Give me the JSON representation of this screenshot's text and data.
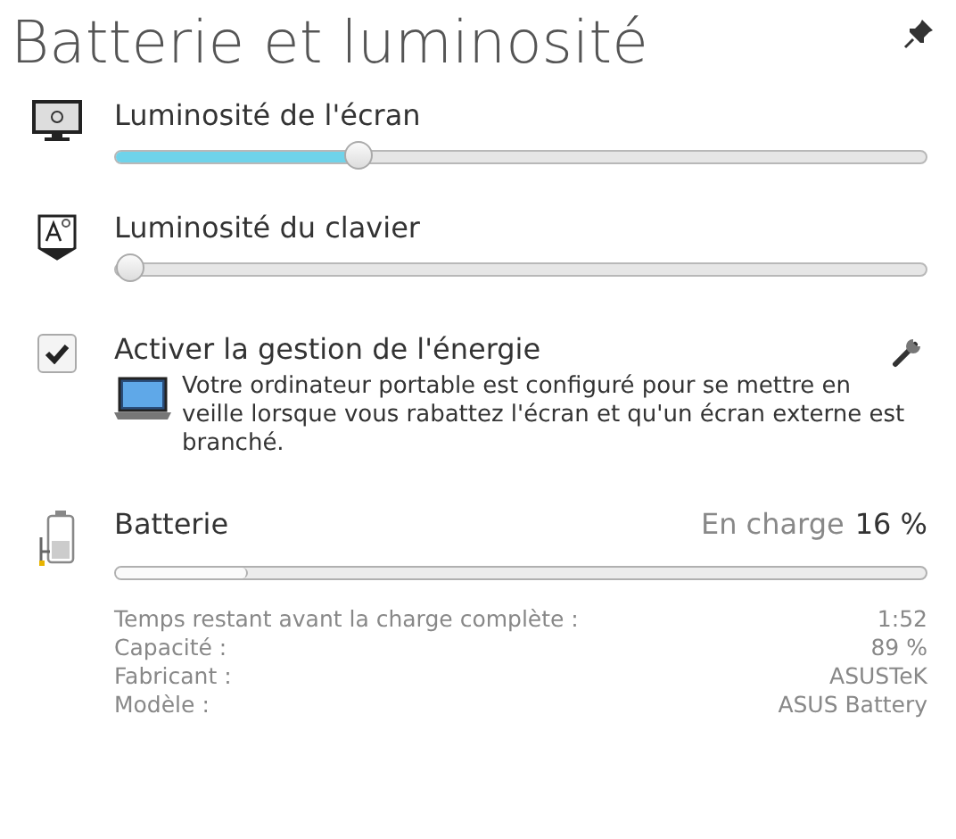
{
  "title": "Batterie et luminosité",
  "sliders": [
    {
      "kind": "screen",
      "label": "Luminosité de l'écran",
      "level": 0.3
    },
    {
      "kind": "keyboard",
      "label": "Luminosité du clavier",
      "level": 0
    }
  ],
  "power_management": {
    "label": "Activer la gestion de l'énergie",
    "checked": true,
    "description": "Votre ordinateur portable est configuré pour se mettre en veille lorsque vous rabattez l'écran et qu'un écran externe est branché."
  },
  "battery": {
    "label": "Batterie",
    "state": "En charge",
    "percent": "16 %",
    "level": 0.16,
    "details": [
      {
        "label": "Temps restant avant la charge complète :",
        "value": "1:52"
      },
      {
        "label": "Capacité :",
        "value": "89 %"
      },
      {
        "label": "Fabricant :",
        "value": "ASUSTeK"
      },
      {
        "label": "Modèle :",
        "value": "ASUS Battery"
      }
    ]
  }
}
